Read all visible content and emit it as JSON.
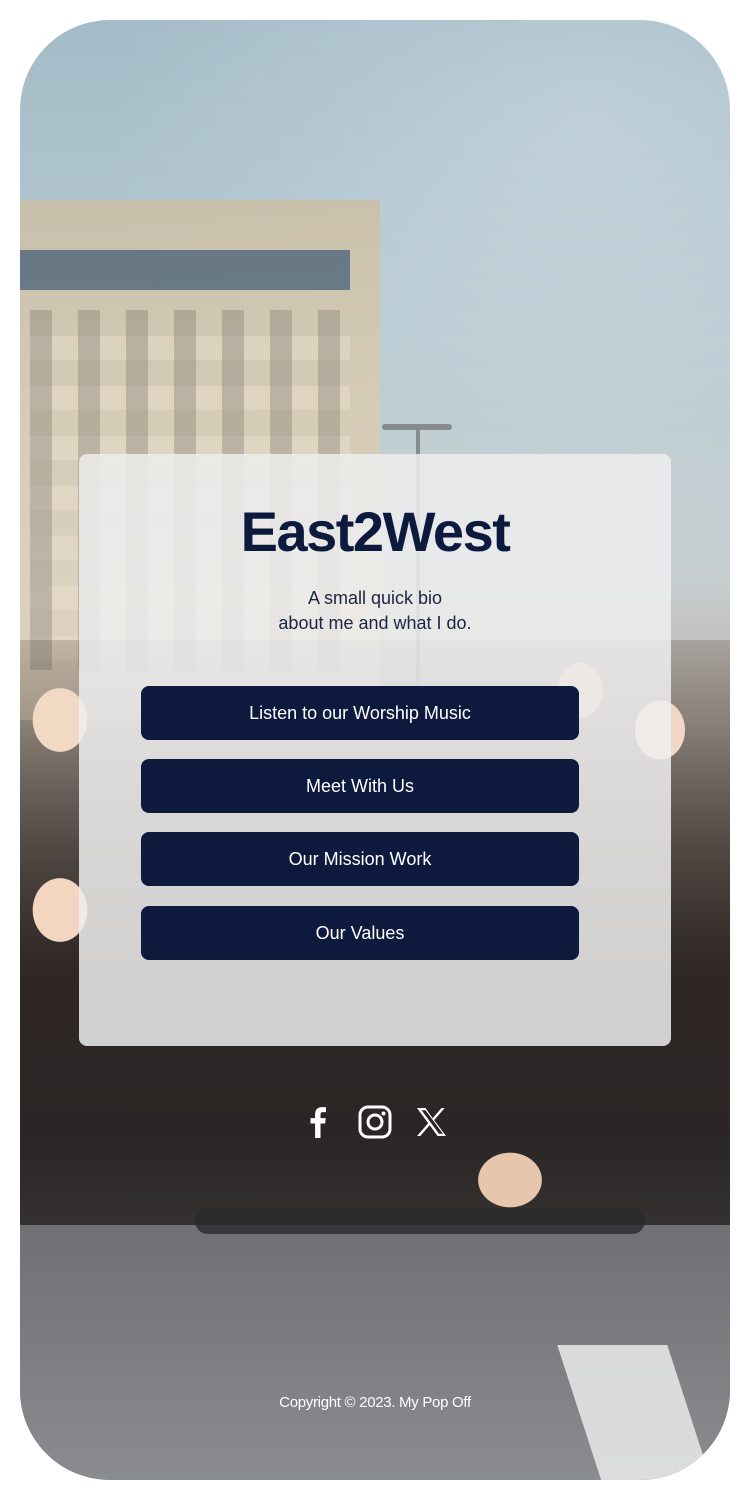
{
  "profile": {
    "title": "East2West",
    "bio_line1": "A small quick bio",
    "bio_line2": "about me and what I do."
  },
  "links": [
    {
      "label": "Listen to our Worship Music"
    },
    {
      "label": "Meet With Us"
    },
    {
      "label": "Our Mission Work"
    },
    {
      "label": "Our Values"
    }
  ],
  "socials": [
    {
      "icon": "facebook-icon"
    },
    {
      "icon": "instagram-icon"
    },
    {
      "icon": "x-twitter-icon"
    }
  ],
  "footer": {
    "copyright": "Copyright © 2023. My Pop Off"
  },
  "colors": {
    "accent": "#0d1a3d",
    "card_background": "#eeeeee",
    "button_text": "#ffffff"
  }
}
